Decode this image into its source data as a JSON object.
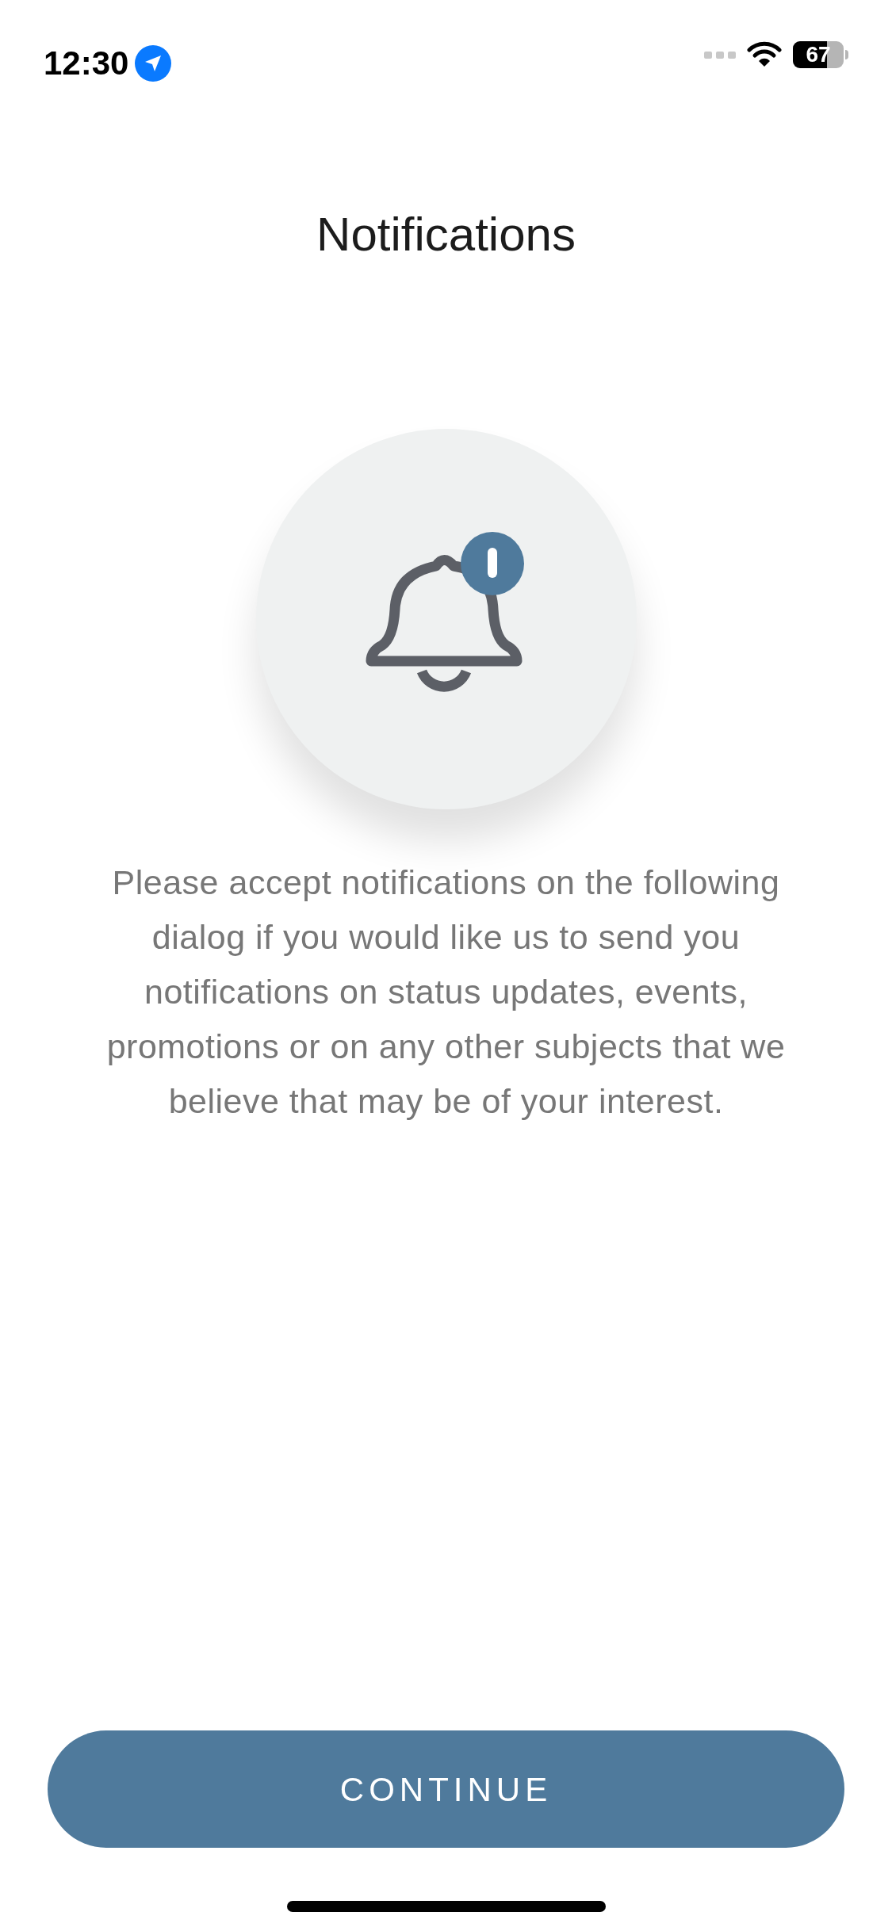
{
  "status_bar": {
    "time": "12:30",
    "battery": "67"
  },
  "title": "Notifications",
  "message": "Please accept notifications on the following dialog if you would like us to send you notifications on status updates, events, promotions or on any other subjects that we believe that may be of your interest.",
  "continue_button": "CONTINUE"
}
